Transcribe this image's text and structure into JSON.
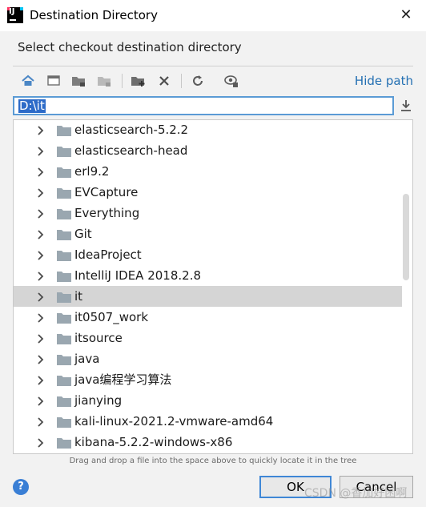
{
  "window": {
    "title": "Destination Directory",
    "app_icon": "intellij-icon",
    "close_glyph": "✕"
  },
  "dialog": {
    "subtitle": "Select checkout destination directory",
    "hide_path_label": "Hide path",
    "path_value": "D:\\it",
    "hint": "Drag and drop a file into the space above to quickly locate it in the tree",
    "help_glyph": "?",
    "ok_label": "OK",
    "cancel_label": "Cancel"
  },
  "toolbar": {
    "icons": [
      "home-icon",
      "desktop-icon",
      "project-folder-icon",
      "module-folder-icon",
      "new-folder-icon",
      "delete-icon",
      "refresh-icon",
      "show-hidden-icon"
    ]
  },
  "tree": {
    "items": [
      {
        "label": "elasticsearch-5.2.2",
        "selected": false
      },
      {
        "label": "elasticsearch-head",
        "selected": false
      },
      {
        "label": "erl9.2",
        "selected": false
      },
      {
        "label": "EVCapture",
        "selected": false
      },
      {
        "label": "Everything",
        "selected": false
      },
      {
        "label": "Git",
        "selected": false
      },
      {
        "label": "IdeaProject",
        "selected": false
      },
      {
        "label": "IntelliJ IDEA 2018.2.8",
        "selected": false
      },
      {
        "label": "it",
        "selected": true
      },
      {
        "label": "it0507_work",
        "selected": false
      },
      {
        "label": "itsource",
        "selected": false
      },
      {
        "label": "java",
        "selected": false
      },
      {
        "label": "java编程学习算法",
        "selected": false
      },
      {
        "label": "jianying",
        "selected": false
      },
      {
        "label": "kali-linux-2021.2-vmware-amd64",
        "selected": false
      },
      {
        "label": "kibana-5.2.2-windows-x86",
        "selected": false
      }
    ]
  },
  "watermark": "CSDN @香加好困啊",
  "colors": {
    "accent": "#3f87d6",
    "link": "#2470b3",
    "selection": "#d5d5d5",
    "folder": "#9aa7b0"
  }
}
